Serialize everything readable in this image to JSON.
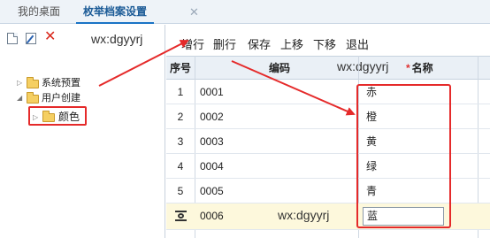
{
  "tabs": {
    "home": "我的桌面",
    "active": "枚举档案设置",
    "close": "✕"
  },
  "left_toolbar": {
    "watermark": "wx:dgyyrj"
  },
  "tree": {
    "system_preset": "系统预置",
    "user_created": "用户创建",
    "color": "颜色"
  },
  "toolbar": {
    "add_row": "增行",
    "delete_row": "删行",
    "save": "保存",
    "move_up": "上移",
    "move_down": "下移",
    "exit": "退出"
  },
  "grid": {
    "headers": {
      "seq": "序号",
      "code": "编码",
      "required_mark": "*",
      "name": "名称"
    },
    "header_watermark": "wx:dgyyrj",
    "rows": [
      {
        "seq": "1",
        "code": "0001",
        "name": "赤"
      },
      {
        "seq": "2",
        "code": "0002",
        "name": "橙"
      },
      {
        "seq": "3",
        "code": "0003",
        "name": "黄"
      },
      {
        "seq": "4",
        "code": "0004",
        "name": "绿"
      },
      {
        "seq": "5",
        "code": "0005",
        "name": "青"
      }
    ],
    "new_row": {
      "code": "0006",
      "name_value": "蓝",
      "watermark": "wx:dgyyrj"
    }
  },
  "colors": {
    "highlight": "#e52a2a",
    "header_bg": "#eaf0f6",
    "new_row_bg": "#fdf8dc",
    "active_tab": "#1a73c6"
  }
}
